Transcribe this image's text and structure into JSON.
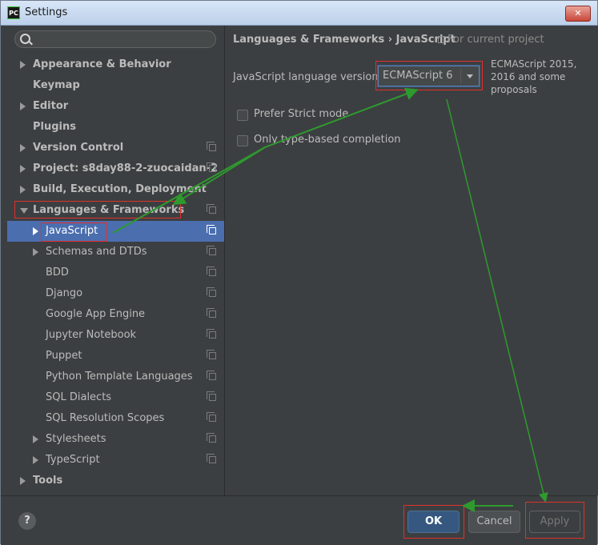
{
  "window": {
    "title": "Settings",
    "app_icon_text": "PC",
    "close_glyph": "✕"
  },
  "sidebar": {
    "search_placeholder": "",
    "items": [
      {
        "label": "Appearance & Behavior",
        "level": 0,
        "arrow": "right",
        "copy": false
      },
      {
        "label": "Keymap",
        "level": 0,
        "arrow": "none",
        "copy": false
      },
      {
        "label": "Editor",
        "level": 0,
        "arrow": "right",
        "copy": false
      },
      {
        "label": "Plugins",
        "level": 0,
        "arrow": "none",
        "copy": false
      },
      {
        "label": "Version Control",
        "level": 0,
        "arrow": "right",
        "copy": true
      },
      {
        "label": "Project: s8day88-2-zuocaidan-2",
        "level": 0,
        "arrow": "right",
        "copy": true
      },
      {
        "label": "Build, Execution, Deployment",
        "level": 0,
        "arrow": "right",
        "copy": false
      },
      {
        "label": "Languages & Frameworks",
        "level": 0,
        "arrow": "down",
        "copy": true
      },
      {
        "label": "JavaScript",
        "level": 1,
        "arrow": "right",
        "copy": true,
        "selected": true
      },
      {
        "label": "Schemas and DTDs",
        "level": 1,
        "arrow": "right",
        "copy": true
      },
      {
        "label": "BDD",
        "level": 1,
        "arrow": "none",
        "copy": true
      },
      {
        "label": "Django",
        "level": 1,
        "arrow": "none",
        "copy": true
      },
      {
        "label": "Google App Engine",
        "level": 1,
        "arrow": "none",
        "copy": true
      },
      {
        "label": "Jupyter Notebook",
        "level": 1,
        "arrow": "none",
        "copy": true
      },
      {
        "label": "Puppet",
        "level": 1,
        "arrow": "none",
        "copy": true
      },
      {
        "label": "Python Template Languages",
        "level": 1,
        "arrow": "none",
        "copy": true
      },
      {
        "label": "SQL Dialects",
        "level": 1,
        "arrow": "none",
        "copy": true
      },
      {
        "label": "SQL Resolution Scopes",
        "level": 1,
        "arrow": "none",
        "copy": true
      },
      {
        "label": "Stylesheets",
        "level": 1,
        "arrow": "right",
        "copy": true
      },
      {
        "label": "TypeScript",
        "level": 1,
        "arrow": "right",
        "copy": true
      },
      {
        "label": "Tools",
        "level": 0,
        "arrow": "right",
        "copy": false
      }
    ]
  },
  "main": {
    "breadcrumb": "Languages & Frameworks › JavaScript",
    "scope": "For current project",
    "language_version_label": "JavaScript language version",
    "language_version_value": "ECMAScript 6",
    "language_version_description": "ECMAScript 2015, 2016 and some proposals",
    "prefer_strict_label": "Prefer Strict mode",
    "prefer_strict_checked": false,
    "type_based_label": "Only type-based completion",
    "type_based_checked": false
  },
  "footer": {
    "help": "?",
    "ok": "OK",
    "cancel": "Cancel",
    "apply": "Apply"
  },
  "colors": {
    "background": "#3c3f41",
    "selection": "#4b6eaf",
    "annotation_red": "#e0302a",
    "annotation_green": "#2e9a2e"
  }
}
